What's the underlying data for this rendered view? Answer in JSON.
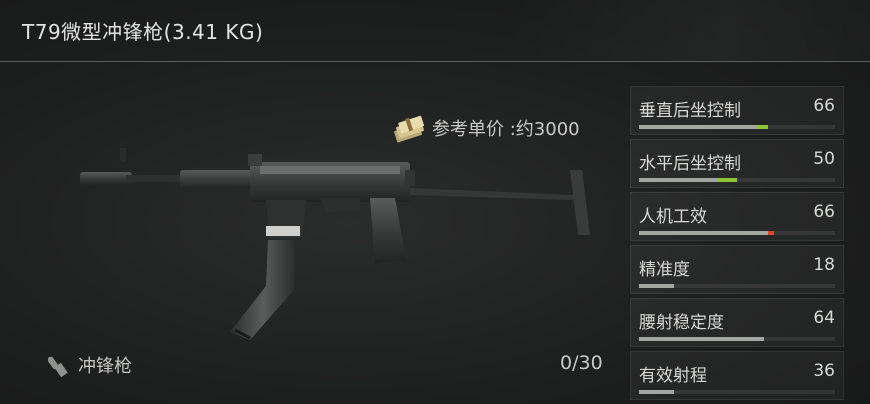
{
  "header": {
    "title": "T79微型冲锋枪(3.41 KG)"
  },
  "price": {
    "label": "参考单价 :约3000",
    "icon": "cash-stack-icon"
  },
  "weapon": {
    "type": "冲锋枪",
    "type_icon": "bullet-icon",
    "ammo": "0/30"
  },
  "colors": {
    "positive": "#8dc43a",
    "negative": "#d9472b",
    "base": "#a4a6a3"
  },
  "stats": [
    {
      "label": "垂直后坐控制",
      "value": "66",
      "base_fraction": 0.6,
      "mod_fraction": 0.66,
      "mod": "positive"
    },
    {
      "label": "水平后坐控制",
      "value": "50",
      "base_fraction": 0.4,
      "mod_fraction": 0.5,
      "mod": "positive"
    },
    {
      "label": "人机工效",
      "value": "66",
      "base_fraction": 0.69,
      "mod_fraction": 0.66,
      "mod": "negative"
    },
    {
      "label": "精准度",
      "value": "18",
      "base_fraction": 0.18,
      "mod_fraction": 0.18,
      "mod": "none"
    },
    {
      "label": "腰射稳定度",
      "value": "64",
      "base_fraction": 0.64,
      "mod_fraction": 0.64,
      "mod": "none"
    },
    {
      "label": "有效射程",
      "value": "36",
      "base_fraction": 0.18,
      "mod_fraction": 0.18,
      "mod": "none"
    }
  ]
}
